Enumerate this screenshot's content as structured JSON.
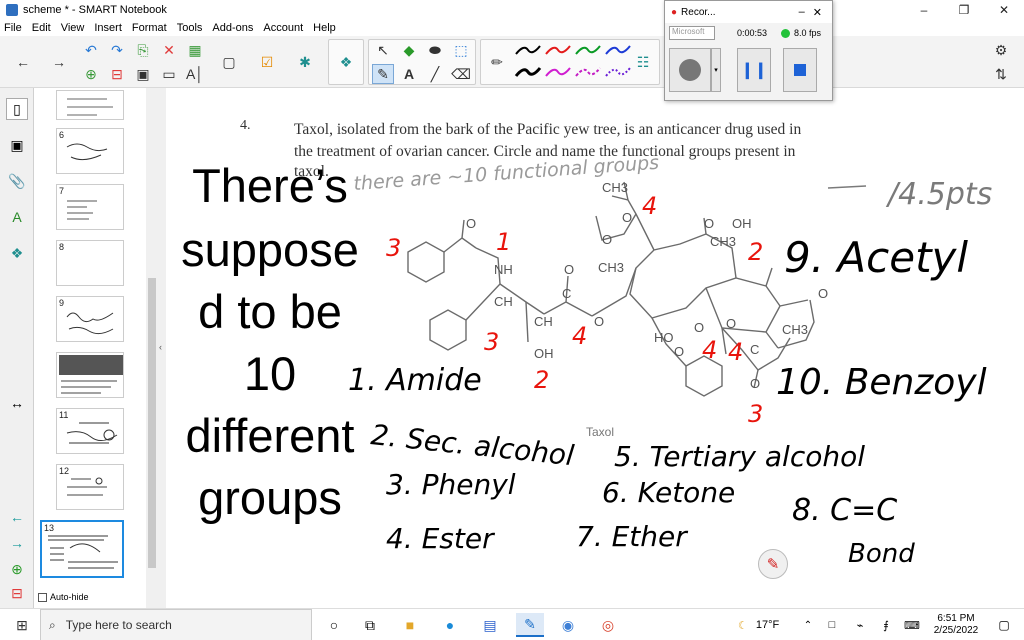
{
  "window": {
    "title": "scheme * - SMART Notebook",
    "controls": [
      "–",
      "❐",
      "✕"
    ]
  },
  "menu": [
    "File",
    "Edit",
    "View",
    "Insert",
    "Format",
    "Tools",
    "Add-ons",
    "Account",
    "Help"
  ],
  "recorder": {
    "title": "Recor...",
    "source": "Microsoft",
    "elapsed": "0:00:53",
    "fps": "8.0 fps",
    "status_color": "#23c23a"
  },
  "sorter": {
    "pages": [
      {
        "num": ""
      },
      {
        "num": "6"
      },
      {
        "num": "7"
      },
      {
        "num": "8"
      },
      {
        "num": "9"
      },
      {
        "num": ""
      },
      {
        "num": "11"
      },
      {
        "num": "12"
      },
      {
        "num": "13"
      }
    ],
    "autohide_label": "Auto-hide"
  },
  "canvas": {
    "question_number": "4.",
    "question_lines": [
      "Taxol, isolated from the bark of the Pacific yew tree, is an anticancer drug used in",
      "the treatment of ovarian cancer. Circle and name the functional groups present in",
      "taxol."
    ],
    "typed_note": [
      "There’s",
      "suppose",
      "d to be",
      "10",
      "different",
      "groups"
    ],
    "molecule_caption": "Taxol",
    "handwritten": {
      "score": "/4.5pts",
      "faint_note": "there are ~10 functional groups",
      "group9": "9. Acetyl",
      "group10": "10. Benzoyl",
      "group1": "1. Amide",
      "group2": "2. Sec. alcohol",
      "group3": "3. Phenyl",
      "group4": "4. Ester",
      "group5": "5. Tertiary alcohol",
      "group6": "6. Ketone",
      "group7": "7. Ether",
      "group8a": "8. C=C",
      "group8b": "Bond"
    },
    "red_numbers": {
      "n1": "1",
      "n2a": "2",
      "n2b": "2",
      "n3a": "3",
      "n3b": "3",
      "n3c": "3",
      "n4a": "4",
      "n4b": "4",
      "n4c": "4",
      "n4d": "4"
    },
    "atom_labels": {
      "O": "O",
      "NH": "NH",
      "CH": "CH",
      "OH": "OH",
      "CH3": "CH3",
      "HO": "HO",
      "C": "C"
    },
    "colors": {
      "ink": "#000000",
      "red": "#e8140c",
      "pencil": "#7a7a7a"
    }
  },
  "taskbar": {
    "search_placeholder": "Type here to search",
    "weather": "17°F",
    "time": "6:51 PM",
    "date": "2/25/2022"
  }
}
